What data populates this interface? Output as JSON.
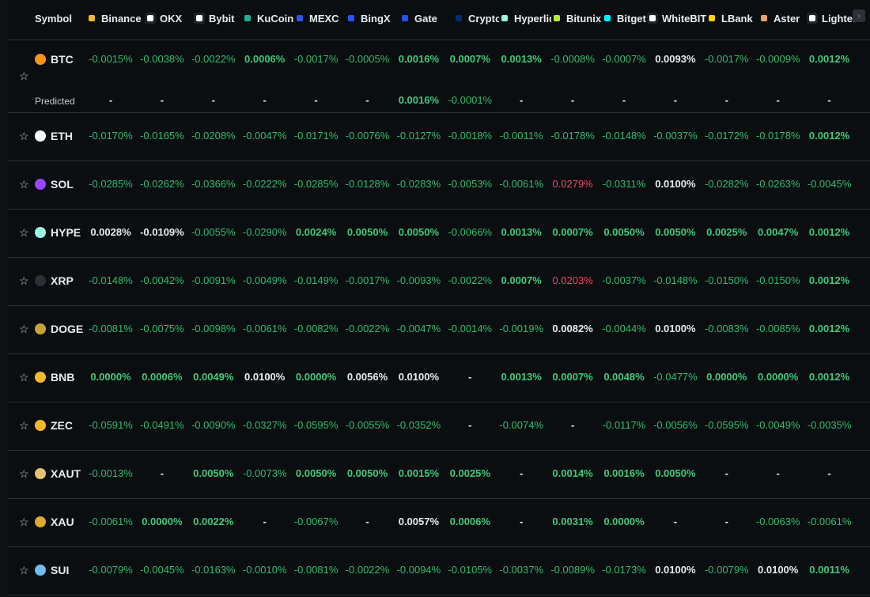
{
  "header": {
    "symbol_label": "Symbol",
    "exchanges": [
      {
        "label": "Binance",
        "icon": "binance-icon",
        "color": "#f3ba2f"
      },
      {
        "label": "OKX",
        "icon": "okx-icon",
        "color": "#ffffff"
      },
      {
        "label": "Bybit",
        "icon": "bybit-icon",
        "color": "#ffffff"
      },
      {
        "label": "KuCoin",
        "icon": "kucoin-icon",
        "color": "#23af91"
      },
      {
        "label": "MEXC",
        "icon": "mexc-icon",
        "color": "#2e55e6"
      },
      {
        "label": "BingX",
        "icon": "bingx-icon",
        "color": "#2a54ff"
      },
      {
        "label": "Gate",
        "icon": "gate-icon",
        "color": "#2354e6"
      },
      {
        "label": "Crypto.com",
        "icon": "crypto-com-icon",
        "color": "#002d74"
      },
      {
        "label": "Hyperliquid",
        "icon": "hyperliquid-icon",
        "color": "#97fce4"
      },
      {
        "label": "Bitunix",
        "icon": "bitunix-icon",
        "color": "#b5ef3c"
      },
      {
        "label": "Bitget",
        "icon": "bitget-icon",
        "color": "#00f0ff"
      },
      {
        "label": "WhiteBIT",
        "icon": "whitebit-icon",
        "color": "#ffffff"
      },
      {
        "label": "LBank",
        "icon": "lbank-icon",
        "color": "#ffd400"
      },
      {
        "label": "Aster",
        "icon": "aster-icon",
        "color": "#e9a26a"
      },
      {
        "label": "Lighter",
        "icon": "lighter-icon",
        "color": "#ffffff"
      }
    ]
  },
  "colors": {
    "positive": "#3ec97a",
    "negative": "#2ebd6b",
    "red": "#f6465d",
    "neutral": "#eaecef",
    "border": "#2b3139",
    "background": "#0b0e11"
  },
  "rows": [
    {
      "symbol": "BTC",
      "icon": "btc-icon",
      "icon_color": "#f7931a",
      "values": [
        "-0.0015%",
        "-0.0038%",
        "-0.0022%",
        "0.0006%",
        "-0.0017%",
        "-0.0005%",
        "0.0016%",
        "0.0007%",
        "0.0013%",
        "-0.0008%",
        "-0.0007%",
        "0.0093%",
        "-0.0017%",
        "-0.0009%",
        "0.0012%"
      ],
      "predicted_label": "Predicted",
      "predicted": [
        "-",
        "-",
        "-",
        "-",
        "-",
        "-",
        "0.0016%",
        "-0.0001%",
        "-",
        "-",
        "-",
        "-",
        "-",
        "-",
        "-"
      ]
    },
    {
      "symbol": "ETH",
      "icon": "eth-icon",
      "icon_color": "#ffffff",
      "values": [
        "-0.0170%",
        "-0.0165%",
        "-0.0208%",
        "-0.0047%",
        "-0.0171%",
        "-0.0076%",
        "-0.0127%",
        "-0.0018%",
        "-0.0011%",
        "-0.0178%",
        "-0.0148%",
        "-0.0037%",
        "-0.0172%",
        "-0.0178%",
        "0.0012%"
      ]
    },
    {
      "symbol": "SOL",
      "icon": "sol-icon",
      "icon_color": "#9945ff",
      "values": [
        "-0.0285%",
        "-0.0262%",
        "-0.0366%",
        "-0.0222%",
        "-0.0285%",
        "-0.0128%",
        "-0.0283%",
        "-0.0053%",
        "-0.0061%",
        "0.0279%",
        "-0.0311%",
        "0.0100%",
        "-0.0282%",
        "-0.0263%",
        "-0.0045%"
      ]
    },
    {
      "symbol": "HYPE",
      "icon": "hype-icon",
      "icon_color": "#97fce4",
      "values": [
        "0.0028%",
        "-0.0109%",
        "-0.0055%",
        "-0.0290%",
        "0.0024%",
        "0.0050%",
        "0.0050%",
        "-0.0066%",
        "0.0013%",
        "0.0007%",
        "0.0050%",
        "0.0050%",
        "0.0025%",
        "0.0047%",
        "0.0012%"
      ]
    },
    {
      "symbol": "XRP",
      "icon": "xrp-icon",
      "icon_color": "#2b3139",
      "values": [
        "-0.0148%",
        "-0.0042%",
        "-0.0091%",
        "-0.0049%",
        "-0.0149%",
        "-0.0017%",
        "-0.0093%",
        "-0.0022%",
        "0.0007%",
        "0.0203%",
        "-0.0037%",
        "-0.0148%",
        "-0.0150%",
        "-0.0150%",
        "0.0012%"
      ]
    },
    {
      "symbol": "DOGE",
      "icon": "doge-icon",
      "icon_color": "#c2a633",
      "values": [
        "-0.0081%",
        "-0.0075%",
        "-0.0098%",
        "-0.0061%",
        "-0.0082%",
        "-0.0022%",
        "-0.0047%",
        "-0.0014%",
        "-0.0019%",
        "0.0082%",
        "-0.0044%",
        "0.0100%",
        "-0.0083%",
        "-0.0085%",
        "0.0012%"
      ]
    },
    {
      "symbol": "BNB",
      "icon": "bnb-icon",
      "icon_color": "#f3ba2f",
      "values": [
        "0.0000%",
        "0.0006%",
        "0.0049%",
        "0.0100%",
        "0.0000%",
        "0.0056%",
        "0.0100%",
        "-",
        "0.0013%",
        "0.0007%",
        "0.0048%",
        "-0.0477%",
        "0.0000%",
        "0.0000%",
        "0.0012%"
      ]
    },
    {
      "symbol": "ZEC",
      "icon": "zec-icon",
      "icon_color": "#f4b728",
      "values": [
        "-0.0591%",
        "-0.0491%",
        "-0.0090%",
        "-0.0327%",
        "-0.0595%",
        "-0.0055%",
        "-0.0352%",
        "-",
        "-0.0074%",
        "-",
        "-0.0117%",
        "-0.0056%",
        "-0.0595%",
        "-0.0049%",
        "-0.0035%"
      ]
    },
    {
      "symbol": "XAUT",
      "icon": "xaut-icon",
      "icon_color": "#e8c170",
      "values": [
        "-0.0013%",
        "-",
        "0.0050%",
        "-0.0073%",
        "0.0050%",
        "0.0050%",
        "0.0015%",
        "0.0025%",
        "-",
        "0.0014%",
        "0.0016%",
        "0.0050%",
        "-",
        "-",
        "-"
      ]
    },
    {
      "symbol": "XAU",
      "icon": "xau-icon",
      "icon_color": "#e0a82e",
      "values": [
        "-0.0061%",
        "0.0000%",
        "0.0022%",
        "-",
        "-0.0067%",
        "-",
        "0.0057%",
        "0.0006%",
        "-",
        "0.0031%",
        "0.0000%",
        "-",
        "-",
        "-0.0063%",
        "-0.0061%"
      ]
    },
    {
      "symbol": "SUI",
      "icon": "sui-icon",
      "icon_color": "#6fbcf0",
      "values": [
        "-0.0079%",
        "-0.0045%",
        "-0.0163%",
        "-0.0010%",
        "-0.0081%",
        "-0.0022%",
        "-0.0094%",
        "-0.0105%",
        "-0.0037%",
        "-0.0089%",
        "-0.0173%",
        "0.0100%",
        "-0.0079%",
        "0.0100%",
        "0.0011%"
      ]
    }
  ],
  "styles": {
    "white_cells": [
      [
        "BTC",
        11
      ],
      [
        "HYPE",
        0
      ],
      [
        "HYPE",
        1
      ],
      [
        "DOGE",
        9
      ],
      [
        "DOGE",
        11
      ],
      [
        "SOL",
        11
      ],
      [
        "BNB",
        3
      ],
      [
        "BNB",
        5
      ],
      [
        "BNB",
        6
      ],
      [
        "XAU",
        6
      ],
      [
        "SUI",
        11
      ],
      [
        "SUI",
        13
      ]
    ],
    "red_cells": [
      [
        "SOL",
        9
      ],
      [
        "XRP",
        9
      ]
    ]
  }
}
